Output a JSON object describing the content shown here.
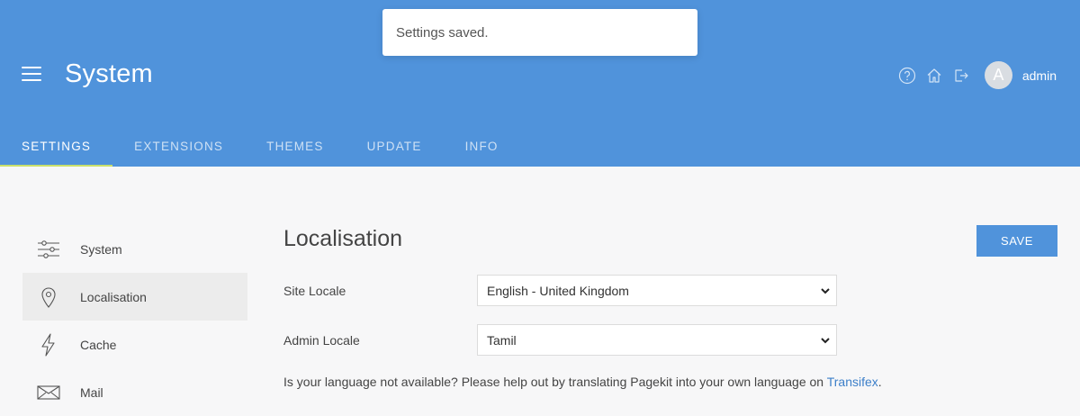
{
  "header": {
    "title": "System",
    "username": "admin",
    "avatar_letter": "A",
    "icons": [
      "menu-icon",
      "help-icon",
      "home-icon",
      "logout-icon"
    ]
  },
  "toast": {
    "message": "Settings saved."
  },
  "tabs": [
    {
      "label": "Settings",
      "active": true
    },
    {
      "label": "Extensions",
      "active": false
    },
    {
      "label": "Themes",
      "active": false
    },
    {
      "label": "Update",
      "active": false
    },
    {
      "label": "Info",
      "active": false
    }
  ],
  "sidebar": {
    "items": [
      {
        "label": "System",
        "icon": "sliders-icon",
        "active": false
      },
      {
        "label": "Localisation",
        "icon": "map-pin-icon",
        "active": true
      },
      {
        "label": "Cache",
        "icon": "lightning-icon",
        "active": false
      },
      {
        "label": "Mail",
        "icon": "mail-icon",
        "active": false
      }
    ]
  },
  "main": {
    "title": "Localisation",
    "save_label": "Save",
    "site_locale": {
      "label": "Site Locale",
      "value": "English - United Kingdom"
    },
    "admin_locale": {
      "label": "Admin Locale",
      "value": "Tamil"
    },
    "help": {
      "text": "Is your language not available? Please help out by translating Pagekit into your own language on ",
      "link": "Transifex",
      "suffix": "."
    }
  },
  "colors": {
    "header_bg": "#5093db",
    "tab_underline": "#c9e06b",
    "link": "#3c7fc9",
    "page_bg": "#f7f7f8"
  }
}
